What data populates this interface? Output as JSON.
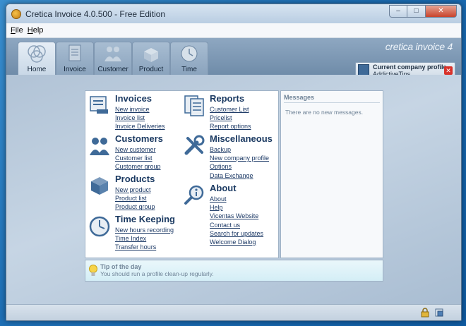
{
  "window": {
    "title": "Cretica Invoice 4.0.500 - Free Edition",
    "controls": {
      "minimize": "‒",
      "maximize": "□",
      "close": "✕"
    }
  },
  "menu": {
    "file_accel": "F",
    "file_rest": "ile",
    "help_accel": "H",
    "help_rest": "elp"
  },
  "ribbon": {
    "brand": "cretica invoice 4",
    "tabs": [
      {
        "label": "Home",
        "icon": "home-icon"
      },
      {
        "label": "Invoice",
        "icon": "invoice-icon"
      },
      {
        "label": "Customer",
        "icon": "customer-icon"
      },
      {
        "label": "Product",
        "icon": "product-icon"
      },
      {
        "label": "Time",
        "icon": "clock-icon"
      }
    ],
    "profile": {
      "title": "Current company profile",
      "name": "AddictiveTips"
    }
  },
  "sections": {
    "invoices": {
      "title": "Invoices",
      "links": [
        "New invoice",
        "Invoice list",
        "Invoice Deliveries"
      ]
    },
    "customers": {
      "title": "Customers",
      "links": [
        "New customer",
        "Customer list",
        "Customer group"
      ]
    },
    "products": {
      "title": "Products",
      "links": [
        "New product",
        "Product list",
        "Product group"
      ]
    },
    "timekeeping": {
      "title": "Time Keeping",
      "links": [
        "New hours recording",
        "Time Index",
        "Transfer hours"
      ]
    },
    "reports": {
      "title": "Reports",
      "links": [
        "Customer List",
        "Pricelist",
        "Report options"
      ]
    },
    "misc": {
      "title": "Miscellaneous",
      "links": [
        "Backup",
        "New company profile",
        "Options",
        "Data Exchange"
      ]
    },
    "about": {
      "title": "About",
      "links": [
        "About",
        "Help",
        "Vicentas Website",
        "Contact us",
        "Search for updates",
        "Welcome Dialog"
      ]
    }
  },
  "messages": {
    "title": "Messages",
    "empty": "There are no new messages."
  },
  "tip": {
    "title": "Tip of the day",
    "body": "You should run a profile clean-up regularly."
  },
  "colors": {
    "link": "#1d3a66",
    "title": "#1b3a62",
    "icon": "#3f6a98"
  }
}
